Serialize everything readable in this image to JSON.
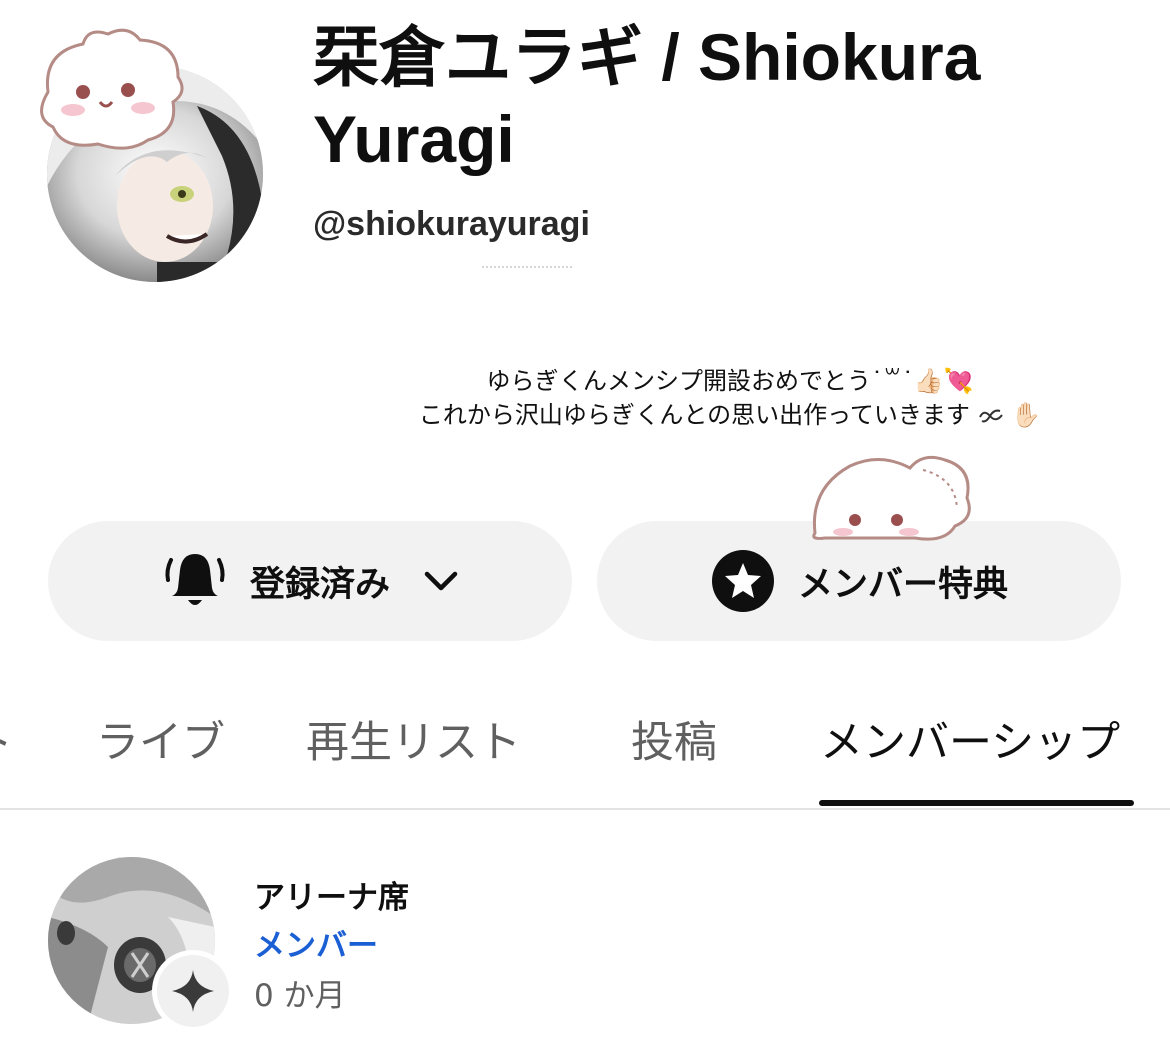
{
  "channel": {
    "name": "栞倉ユラギ / Shiokura Yuragi",
    "handle": "@shiokurayuragi",
    "avatar_icon": "channel-avatar"
  },
  "overlay": {
    "line1": "ゆらぎくんメンシプ開設おめでとう",
    "line1_kaomoji": "˙꒳˙",
    "line1_emoji": "👍🏻💘",
    "line2": "これから沢山ゆらぎくんとの思い出作っていきます",
    "line2_emoji": "✋🏻"
  },
  "actions": {
    "subscribe_label": "登録済み",
    "subscribe_icon": "bell-icon",
    "perks_label": "メンバー特典",
    "perks_icon": "star-icon"
  },
  "tabs": [
    {
      "label": "ト"
    },
    {
      "label": "ライブ"
    },
    {
      "label": "再生リスト"
    },
    {
      "label": "投稿"
    },
    {
      "label": "メンバーシップ",
      "selected": true
    }
  ],
  "membership": {
    "tier": "アリーナ席",
    "status": "メンバー",
    "duration": "0 か月",
    "badge_icon": "sparkle-badge-icon"
  },
  "colors": {
    "pill_background": "#f2f2f2",
    "member_blue": "#1a5fd3",
    "tab_inactive": "#606060",
    "text": "#0f0f0f"
  }
}
